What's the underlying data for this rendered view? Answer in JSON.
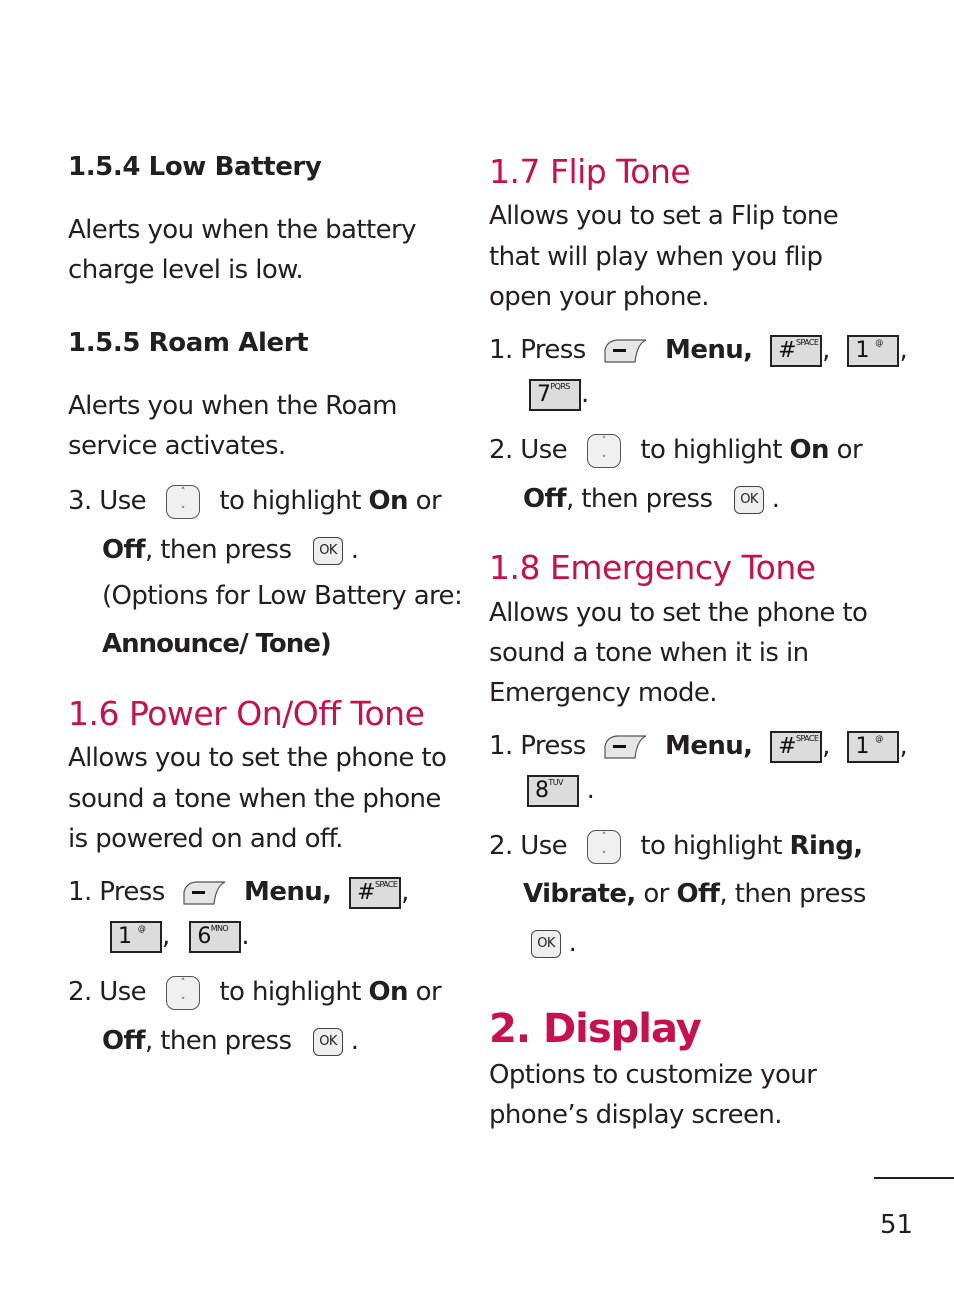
{
  "colors": {
    "heading": "#c8104f",
    "text": "#231f20"
  },
  "left": {
    "s154": {
      "title": "1.5.4 Low Battery",
      "desc_lines": [
        "Alerts you when the battery",
        "charge level is low."
      ]
    },
    "s155": {
      "title": "1.5.5 Roam Alert",
      "desc_lines": [
        "Alerts you when the Roam",
        "service activates."
      ],
      "step3": {
        "num": "3. Use",
        "mid": "to highlight",
        "on": "On",
        "or": "or",
        "off": "Off",
        "then": ", then press",
        "period": "."
      },
      "options_line1": "(Options for Low Battery are:",
      "options_line2": "Announce/ Tone)"
    },
    "s16": {
      "title": "1.6 Power On/Off Tone",
      "desc_lines": [
        "Allows you to set the phone to",
        "sound a tone when the phone",
        "is powered on and off."
      ],
      "step1": {
        "num": "1. Press",
        "menu": "Menu,",
        "sep": ",",
        "end": "."
      },
      "step2": {
        "num": "2. Use",
        "mid": "to highlight",
        "on": "On",
        "or": "or",
        "off": "Off",
        "then": ", then press",
        "period": "."
      }
    }
  },
  "right": {
    "s17": {
      "title": "1.7 Flip Tone",
      "desc_lines": [
        "Allows you to set a Flip tone",
        "that will play when you flip",
        "open your phone."
      ],
      "step1": {
        "num": "1. Press",
        "menu": "Menu,",
        "sep": ",",
        "end": "."
      },
      "step2": {
        "num": "2. Use",
        "mid": "to highlight",
        "on": "On",
        "or": "or",
        "off": "Off",
        "then": ", then press",
        "period": "."
      }
    },
    "s18": {
      "title": "1.8 Emergency Tone",
      "desc_lines": [
        "Allows you to set the phone to",
        "sound a tone when it is in",
        "Emergency mode."
      ],
      "step1": {
        "num": "1. Press",
        "menu": "Menu,",
        "sep": ",",
        "end": "."
      },
      "step2": {
        "num": "2. Use",
        "mid": "to highlight",
        "ring": "Ring,",
        "vibrate": "Vibrate,",
        "or": "or",
        "off": "Off",
        "then": ", then press",
        "period": "."
      }
    },
    "s2": {
      "title": "2. Display",
      "desc_lines": [
        "Options to customize your",
        "phone’s display screen."
      ]
    }
  },
  "keys": {
    "ok": "OK",
    "up": "˄",
    "down": "˅",
    "hash": "#",
    "space": "SPACE",
    "one": "1",
    "at": "@",
    "six": "6",
    "mno": "MNO",
    "seven": "7",
    "pqrs": "PQRS",
    "eight": "8",
    "tuv": "TUV",
    "minus": "−"
  },
  "footer": {
    "page_number": "51"
  }
}
